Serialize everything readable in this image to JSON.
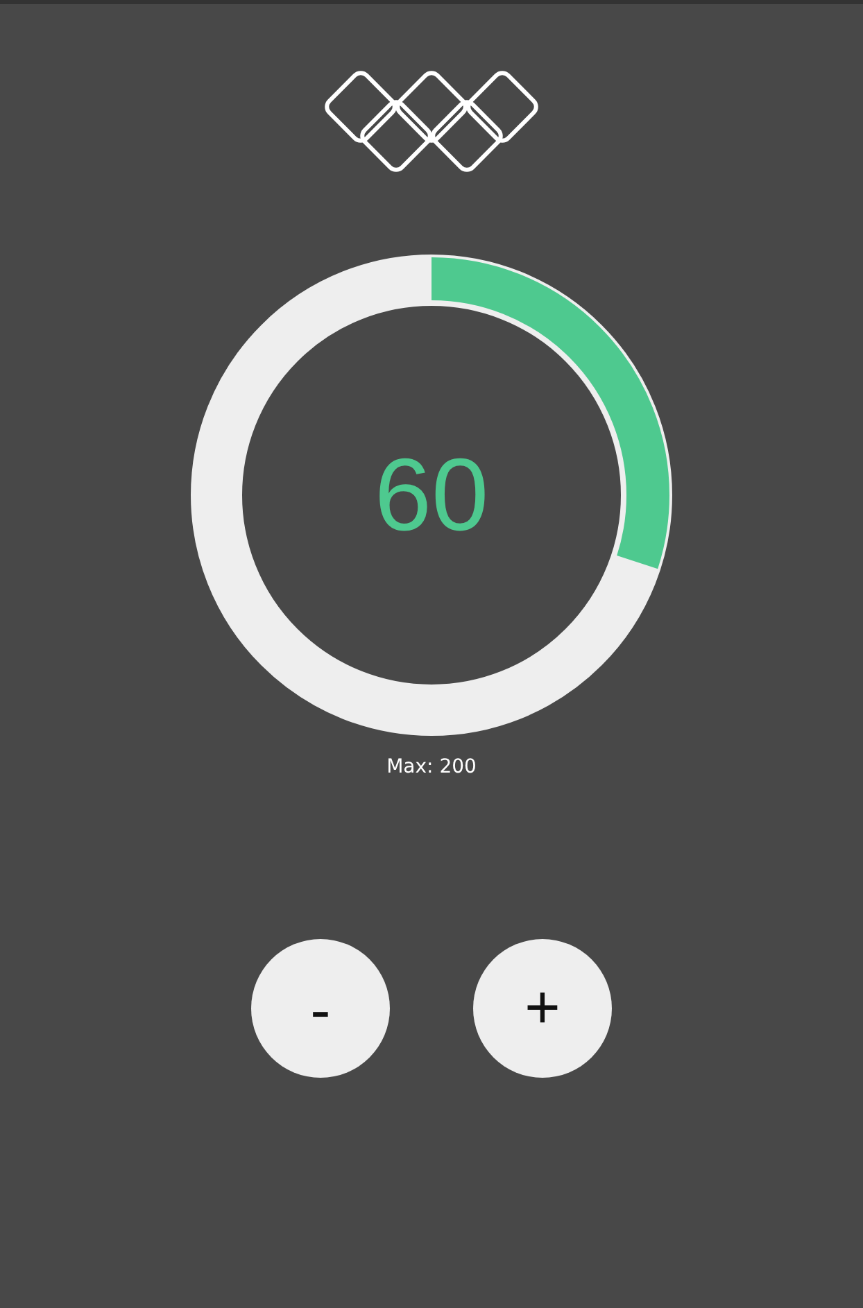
{
  "counter": {
    "value": "60",
    "level": 0.3,
    "max_label": "Max: 200"
  },
  "buttons": [
    {
      "kind": "decrement",
      "label": "-"
    },
    {
      "kind": "increment",
      "label": "+"
    }
  ]
}
